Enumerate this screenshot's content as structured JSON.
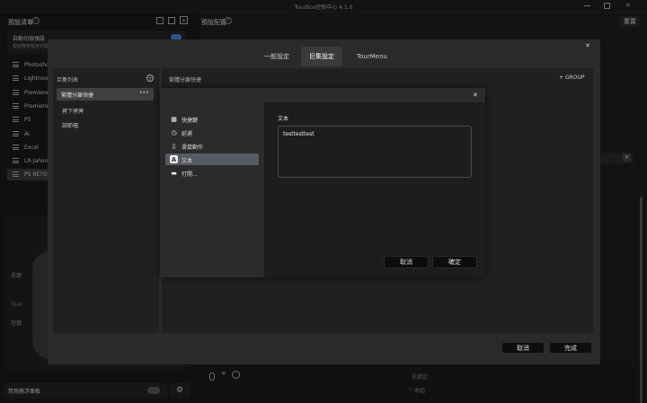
{
  "window": {
    "title": "TourBox控制中心 4.1.0"
  },
  "left_panel": {
    "presets_title": "預設清單",
    "auto_switch_title": "自動切換預設",
    "auto_switch_sub": "根據應用程序切換",
    "presets": [
      "Photosho",
      "Lightroon",
      "Premiere-",
      "Premiere-",
      "PS",
      "Ai",
      "Excel",
      "LR-Jahon",
      "PS RETOU"
    ],
    "device_labels": [
      "長鍵",
      "Tour",
      "短鍵"
    ],
    "footer_label": "禁用懸浮面板"
  },
  "right_panel": {
    "title": "預設配置",
    "reset_label": "重置",
    "bottom_label": "長鍵定",
    "collapse_label": "收起"
  },
  "settings_dialog": {
    "tabs": [
      "一般設定",
      "巨集設定",
      "TourMenu"
    ],
    "active_tab": 1,
    "macro_list_title": "巨集列表",
    "macros": [
      "繁體分離快捷",
      "拷下拷俾",
      "調節幅"
    ],
    "group_header": "繁體分離快捷",
    "add_group_label": "GROUP",
    "cancel_label": "取消",
    "done_label": "完成"
  },
  "action_dialog": {
    "menu": [
      {
        "label": "快捷鍵",
        "icon": "keyboard-icon"
      },
      {
        "label": "延遲",
        "icon": "timer-icon"
      },
      {
        "label": "滑鼠動作",
        "icon": "mouse-icon"
      },
      {
        "label": "文本",
        "icon": "text-icon"
      },
      {
        "label": "打開...",
        "icon": "folder-icon"
      }
    ],
    "selected_index": 3,
    "content_title": "文本",
    "text_value": "testtesttest",
    "cancel_label": "取消",
    "confirm_label": "確定"
  },
  "colors": {
    "accent": "#4a7fd6",
    "selected": "#575c63"
  }
}
